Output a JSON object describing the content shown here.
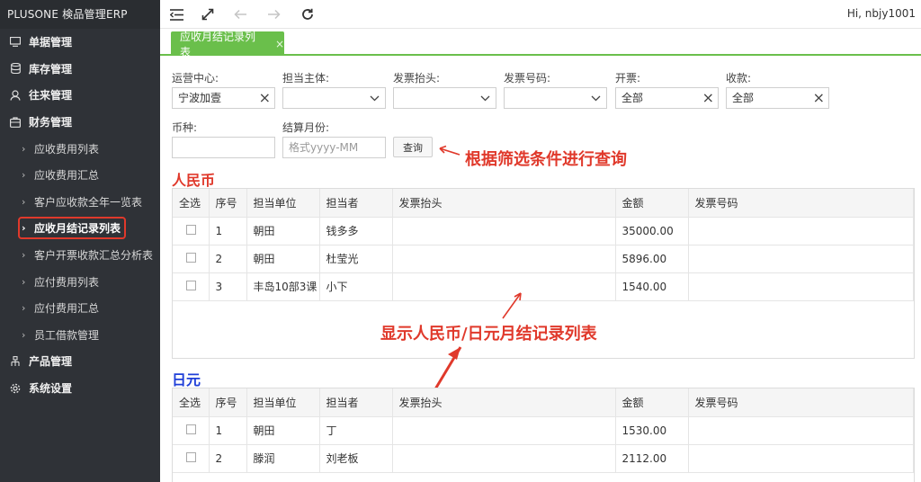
{
  "brand": "PLUSONE 検品管理ERP",
  "topbar": {
    "icons": [
      "menu-collapse-icon",
      "fullscreen-icon",
      "back-icon",
      "forward-icon",
      "refresh-icon"
    ],
    "greeting": "Hi, nbjy1001"
  },
  "sidebar": {
    "menus": [
      {
        "icon": "monitor-icon",
        "label": "单据管理"
      },
      {
        "icon": "database-icon",
        "label": "库存管理"
      },
      {
        "icon": "user-icon",
        "label": "往来管理"
      },
      {
        "icon": "finance-icon",
        "label": "财务管理"
      }
    ],
    "finance_items": [
      "应收费用列表",
      "应收费用汇总",
      "客户应收款全年一览表",
      "应收月结记录列表",
      "客户开票收款汇总分析表",
      "应付费用列表",
      "应付费用汇总",
      "员工借款管理"
    ],
    "bottom_menus": [
      {
        "icon": "product-icon",
        "label": "产品管理"
      },
      {
        "icon": "gear-icon",
        "label": "系统设置"
      }
    ]
  },
  "tab": {
    "label": "应收月结记录列表",
    "close": "×"
  },
  "filters": {
    "ops_center": {
      "label": "运营中心:",
      "value": "宁波加壹"
    },
    "owner": {
      "label": "担当主体:",
      "value": ""
    },
    "invoice_title": {
      "label": "发票抬头:",
      "value": ""
    },
    "invoice_no": {
      "label": "发票号码:",
      "value": ""
    },
    "invoiced": {
      "label": "开票:",
      "value": "全部"
    },
    "received": {
      "label": "收款:",
      "value": "全部"
    },
    "currency": {
      "label": "币种:",
      "value": ""
    },
    "settle_month": {
      "label": "结算月份:",
      "placeholder": "格式yyyy-MM"
    },
    "query_button": "查询"
  },
  "annotations": {
    "query_note": "根据筛选条件进行查询",
    "list_note": "显示人民币/日元月结记录列表"
  },
  "colors": {
    "accent": "#6abf4b",
    "annotation": "#e0392b",
    "rmb_title": "#e0392b",
    "jpy_title": "#1f3fd8"
  },
  "tables": {
    "columns": [
      "全选",
      "序号",
      "担当单位",
      "担当者",
      "发票抬头",
      "金额",
      "发票号码"
    ],
    "rmb": {
      "title": "人民币",
      "rows": [
        {
          "no": "1",
          "unit": "朝田",
          "person": "钱多多",
          "title": "",
          "amount": "35000.00",
          "invoice": ""
        },
        {
          "no": "2",
          "unit": "朝田",
          "person": "杜莹光",
          "title": "",
          "amount": "5896.00",
          "invoice": ""
        },
        {
          "no": "3",
          "unit": "丰岛10部3课",
          "person": "小下",
          "title": "",
          "amount": "1540.00",
          "invoice": ""
        }
      ]
    },
    "jpy": {
      "title": "日元",
      "rows": [
        {
          "no": "1",
          "unit": "朝田",
          "person": "丁",
          "title": "",
          "amount": "1530.00",
          "invoice": ""
        },
        {
          "no": "2",
          "unit": "滕润",
          "person": "刘老板",
          "title": "",
          "amount": "2112.00",
          "invoice": ""
        }
      ]
    }
  }
}
